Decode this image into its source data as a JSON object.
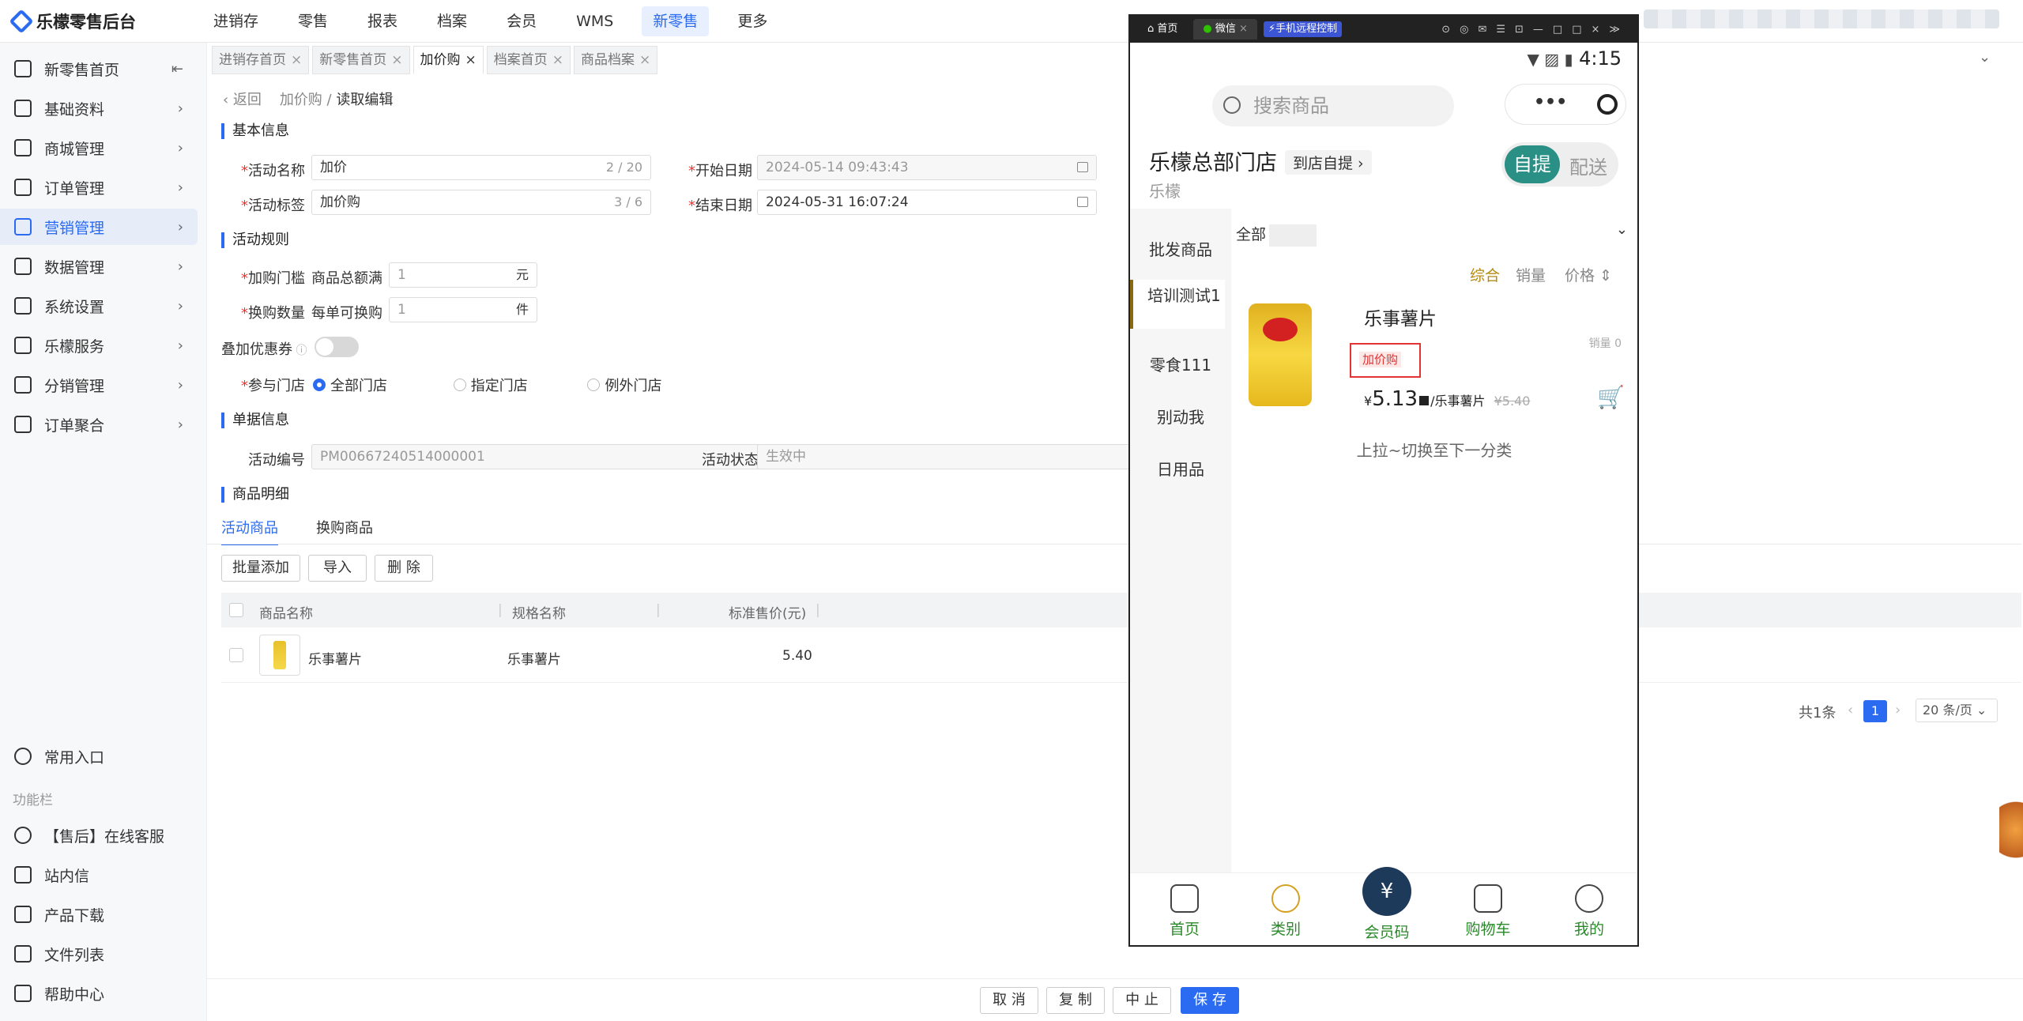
{
  "app": {
    "logo": "乐檬零售后台"
  },
  "topnav": [
    "进销存",
    "零售",
    "报表",
    "档案",
    "会员",
    "WMS",
    "新零售",
    "更多"
  ],
  "sidebar": {
    "items": [
      {
        "label": "新零售首页",
        "icon": "home-icon"
      },
      {
        "label": "基础资料",
        "icon": "grid-icon"
      },
      {
        "label": "商城管理",
        "icon": "shop-icon"
      },
      {
        "label": "订单管理",
        "icon": "order-icon"
      },
      {
        "label": "营销管理",
        "icon": "marketing-icon"
      },
      {
        "label": "数据管理",
        "icon": "chart-icon"
      },
      {
        "label": "系统设置",
        "icon": "gear-icon"
      },
      {
        "label": "乐檬服务",
        "icon": "service-icon"
      },
      {
        "label": "分销管理",
        "icon": "distribution-icon"
      },
      {
        "label": "订单聚合",
        "icon": "aggregate-icon"
      }
    ],
    "common_entry": "常用入口",
    "function_bar": "功能栏",
    "bottom": [
      "【售后】在线客服",
      "站内信",
      "产品下载",
      "文件列表",
      "帮助中心"
    ]
  },
  "tabs": [
    {
      "label": "进销存首页"
    },
    {
      "label": "新零售首页"
    },
    {
      "label": "加价购"
    },
    {
      "label": "档案首页"
    },
    {
      "label": "商品档案"
    }
  ],
  "breadcrumb": {
    "back": "返回",
    "parent": "加价购",
    "current": "读取编辑"
  },
  "form": {
    "basic_title": "基本信息",
    "name_label": "活动名称",
    "name_value": "加价",
    "name_count": "2 / 20",
    "tag_label": "活动标签",
    "tag_value": "加价购",
    "tag_count": "3 / 6",
    "start_label": "开始日期",
    "start_value": "2024-05-14 09:43:43",
    "end_label": "结束日期",
    "end_value": "2024-05-31 16:07:24",
    "rules_title": "活动规则",
    "threshold_label": "加购门槛",
    "threshold_prefix": "商品总额满",
    "threshold_value": "1",
    "threshold_unit": "元",
    "qty_label": "换购数量",
    "qty_prefix": "每单可换购",
    "qty_value": "1",
    "qty_unit": "件",
    "coupon_label": "叠加优惠券",
    "store_label": "参与门店",
    "store_options": [
      "全部门店",
      "指定门店",
      "例外门店"
    ],
    "doc_title": "单据信息",
    "code_label": "活动编号",
    "code_value": "PM00667240514000001",
    "status_label": "活动状态",
    "status_value": "生效中",
    "detail_title": "商品明细"
  },
  "subtabs": [
    "活动商品",
    "换购商品"
  ],
  "buttons": {
    "batch_add": "批量添加",
    "import": "导入",
    "delete": "删 除",
    "cancel": "取 消",
    "copy": "复 制",
    "stop": "中 止",
    "save": "保 存"
  },
  "table": {
    "headers": [
      "商品名称",
      "规格名称",
      "标准售价(元)"
    ],
    "rows": [
      {
        "name": "乐事薯片",
        "spec": "乐事薯片",
        "price": "5.40"
      }
    ]
  },
  "pager": {
    "total": "共1条",
    "page": "1",
    "size": "20 条/页"
  },
  "phone": {
    "tabs": [
      "首页",
      "微信",
      "手机远程控制"
    ],
    "time": "4:15",
    "search_placeholder": "搜索商品",
    "store_name": "乐檬总部门店",
    "pickup_label": "到店自提",
    "store_sub": "乐檬",
    "seg_a": "自提",
    "seg_b": "配送",
    "categories": [
      "批发商品",
      "培训测试1",
      "零食111",
      "别动我",
      "日用品"
    ],
    "filter_all": "全部",
    "sort": [
      "综合",
      "销量",
      "价格"
    ],
    "product": {
      "name": "乐事薯片",
      "sales": "销量 0",
      "tag": "加价购",
      "price_sym": "¥",
      "price": "5.13",
      "unit": "/乐事薯片",
      "orig": "¥5.40"
    },
    "pull_hint": "上拉~切换至下一分类",
    "bottom_nav": [
      "首页",
      "类别",
      "会员码",
      "购物车",
      "我的"
    ]
  },
  "colors": {
    "accent": "#2a6bf2",
    "brand_green": "#2a8f85",
    "tag_red": "#e33333"
  }
}
